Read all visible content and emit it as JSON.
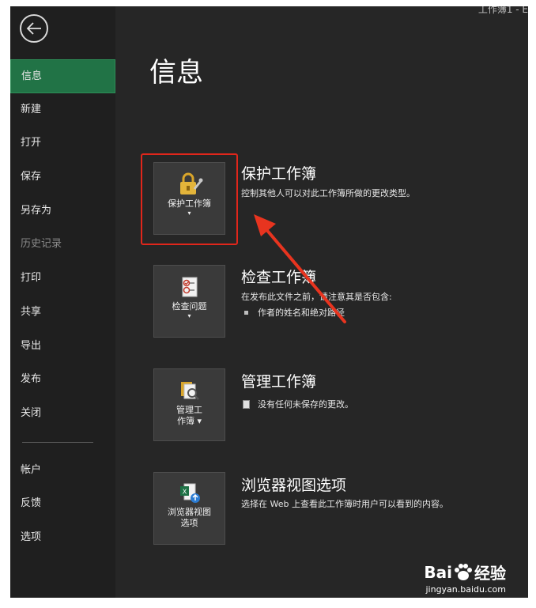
{
  "window": {
    "title_snippet": "工作簿1 - E"
  },
  "sidebar": {
    "items": [
      {
        "label": "信息",
        "active": true
      },
      {
        "label": "新建"
      },
      {
        "label": "打开"
      },
      {
        "label": "保存"
      },
      {
        "label": "另存为"
      },
      {
        "label": "历史记录",
        "disabled": true
      },
      {
        "label": "打印"
      },
      {
        "label": "共享"
      },
      {
        "label": "导出"
      },
      {
        "label": "发布"
      },
      {
        "label": "关闭"
      }
    ],
    "bottom_items": [
      {
        "label": "帐户"
      },
      {
        "label": "反馈"
      },
      {
        "label": "选项"
      }
    ]
  },
  "main": {
    "title": "信息",
    "sections": [
      {
        "button_label": "保护工作簿",
        "title": "保护工作簿",
        "desc": "控制其他人可以对此工作簿所做的更改类型。"
      },
      {
        "button_label": "检查问题",
        "title": "检查工作簿",
        "desc": "在发布此文件之前，请注意其是否包含:",
        "bullet": "作者的姓名和绝对路径"
      },
      {
        "button_label_1": "管理工",
        "button_label_2": "作簿",
        "title": "管理工作簿",
        "bullet": "没有任何未保存的更改。"
      },
      {
        "button_label_1": "浏览器视图",
        "button_label_2": "选项",
        "title": "浏览器视图选项",
        "desc": "选择在 Web 上查看此工作簿时用户可以看到的内容。"
      }
    ]
  },
  "watermark": {
    "brand_left": "Bai",
    "brand_right": "经验",
    "url": "jingyan.baidu.com"
  },
  "colors": {
    "active_green": "#217346",
    "highlight_red": "#e0261b",
    "arrow_red": "#e8341f"
  }
}
